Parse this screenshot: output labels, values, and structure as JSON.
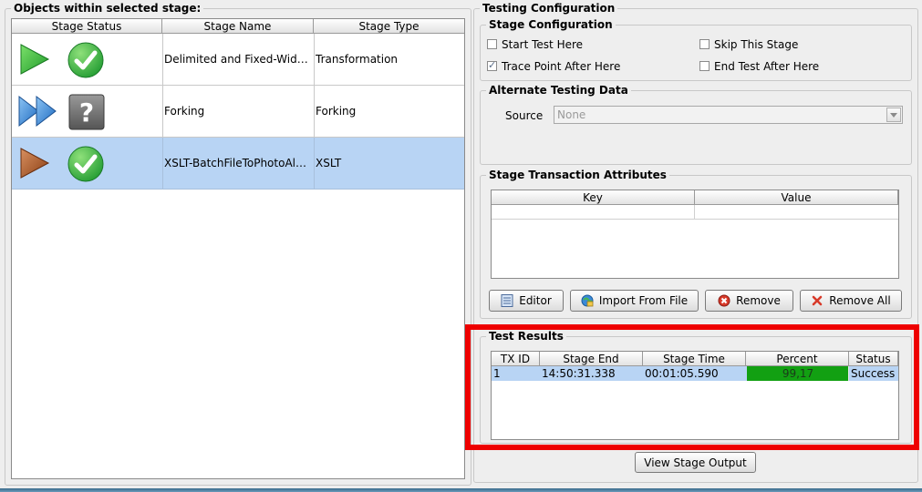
{
  "left_panel": {
    "title": "Objects within selected stage:",
    "columns": [
      "Stage Status",
      "Stage Name",
      "Stage Type"
    ],
    "rows": [
      {
        "name": "Delimited and Fixed-Width F...",
        "type": "Transformation",
        "stage_icon": "play-green-icon",
        "status_icon": "check-icon"
      },
      {
        "name": "Forking",
        "type": "Forking",
        "stage_icon": "fast-forward-blue-icon",
        "status_icon": "question-icon"
      },
      {
        "name": "XSLT-BatchFileToPhotoAlbu...",
        "type": "XSLT",
        "stage_icon": "play-brown-icon",
        "status_icon": "check-icon"
      }
    ],
    "selected_row": 2
  },
  "testing_config": {
    "title": "Testing Configuration",
    "stage_config": {
      "title": "Stage Configuration",
      "start_test_here": {
        "label": "Start Test Here",
        "checked": false
      },
      "skip_this_stage": {
        "label": "Skip This Stage",
        "checked": false
      },
      "trace_point_after_here": {
        "label": "Trace Point After Here",
        "checked": true
      },
      "end_test_after_here": {
        "label": "End Test After Here",
        "checked": false
      }
    },
    "alt_data": {
      "title": "Alternate Testing Data",
      "source_label": "Source",
      "source_value": "None"
    },
    "transaction_attrs": {
      "title": "Stage Transaction Attributes",
      "columns": [
        "Key",
        "Value"
      ],
      "buttons": {
        "editor": "Editor",
        "import": "Import From File",
        "remove": "Remove",
        "remove_all": "Remove All"
      }
    },
    "test_results": {
      "title": "Test Results",
      "columns": [
        "TX ID",
        "Stage End",
        "Stage Time",
        "Percent",
        "Status"
      ],
      "rows": [
        {
          "tx_id": "1",
          "stage_end": "14:50:31.338",
          "stage_time": "00:01:05.590",
          "percent": "99,17",
          "status": "Success"
        }
      ]
    },
    "view_output_button": "View Stage Output"
  },
  "colors": {
    "selection": "#b8d4f4",
    "percent_bar": "#12a012",
    "highlight_border": "#ee0000"
  }
}
